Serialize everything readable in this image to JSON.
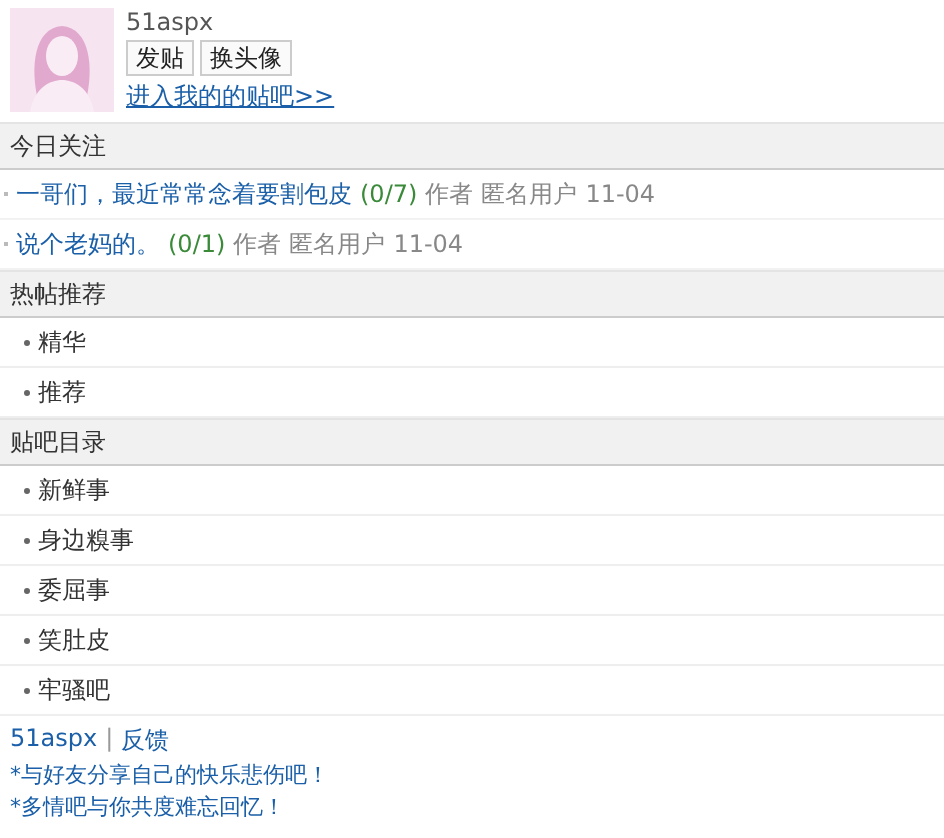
{
  "profile": {
    "username": "51aspx",
    "buttons": [
      "发贴",
      "换头像"
    ],
    "link": "进入我的的贴吧>>"
  },
  "sections": [
    {
      "title": "今日关注",
      "kind": "posts",
      "posts": [
        {
          "title": "一哥们，最近常常念着要割包皮",
          "count": "(0/7)",
          "author_label": "作者",
          "author": "匿名用户",
          "date": "11-04"
        },
        {
          "title": "说个老妈的。",
          "count": "(0/1)",
          "author_label": "作者",
          "author": "匿名用户",
          "date": "11-04"
        }
      ]
    },
    {
      "title": "热帖推荐",
      "kind": "list",
      "items": [
        "精华",
        "推荐"
      ]
    },
    {
      "title": "贴吧目录",
      "kind": "list",
      "items": [
        "新鲜事",
        "身边糗事",
        "委屈事",
        "笑肚皮",
        "牢骚吧"
      ]
    }
  ],
  "footer": {
    "links": [
      "51aspx",
      "反馈"
    ],
    "separator": "|",
    "lines": [
      "*与好友分享自己的快乐悲伤吧！",
      "*多情吧与你共度难忘回忆！"
    ]
  }
}
